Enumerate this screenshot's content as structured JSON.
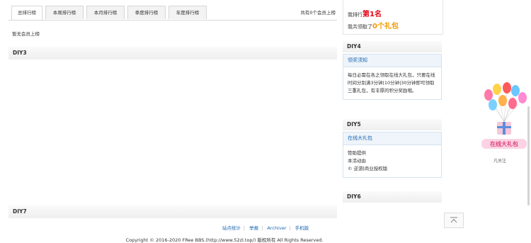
{
  "tabs": [
    "总排行榜",
    "本周排行榜",
    "本月排行榜",
    "季度排行榜",
    "年度排行榜"
  ],
  "member_count": "共有0个会员上榜",
  "empty_message": "暂无会员上榜",
  "diy3": "DIY3",
  "diy7": "DIY7",
  "rank": {
    "prefix": "我排行",
    "value": "第1名",
    "claim_prefix": "我共领取了",
    "claim_value": "0个礼包"
  },
  "diy4": "DIY4",
  "notice": {
    "title": "领奖须知",
    "body": "每日必需在各之领取在线大礼包，只要在线时间分别满3分钟|10分钟|30分钟即可领取三重礼包，有丰厚的积分奖励哦。"
  },
  "diy5": "DIY5",
  "gift": {
    "title": "在线大礼包",
    "line1": "赞助提供",
    "line2": "本活动由",
    "line3": "© 逆游|商业授权版"
  },
  "diy6": "DIY6",
  "gift_widget": {
    "banner": "在线大礼包",
    "sub": "凡关注"
  },
  "footer": {
    "links": [
      "站点统计",
      "举报",
      "Archiver",
      "手机版"
    ],
    "copyright": "Copyright © 2016-2020 FRee BBS.(http://www.52zl.top/) 版权所有 All Rights Reserved."
  },
  "back_to_top_icon": "back-to-top-icon"
}
